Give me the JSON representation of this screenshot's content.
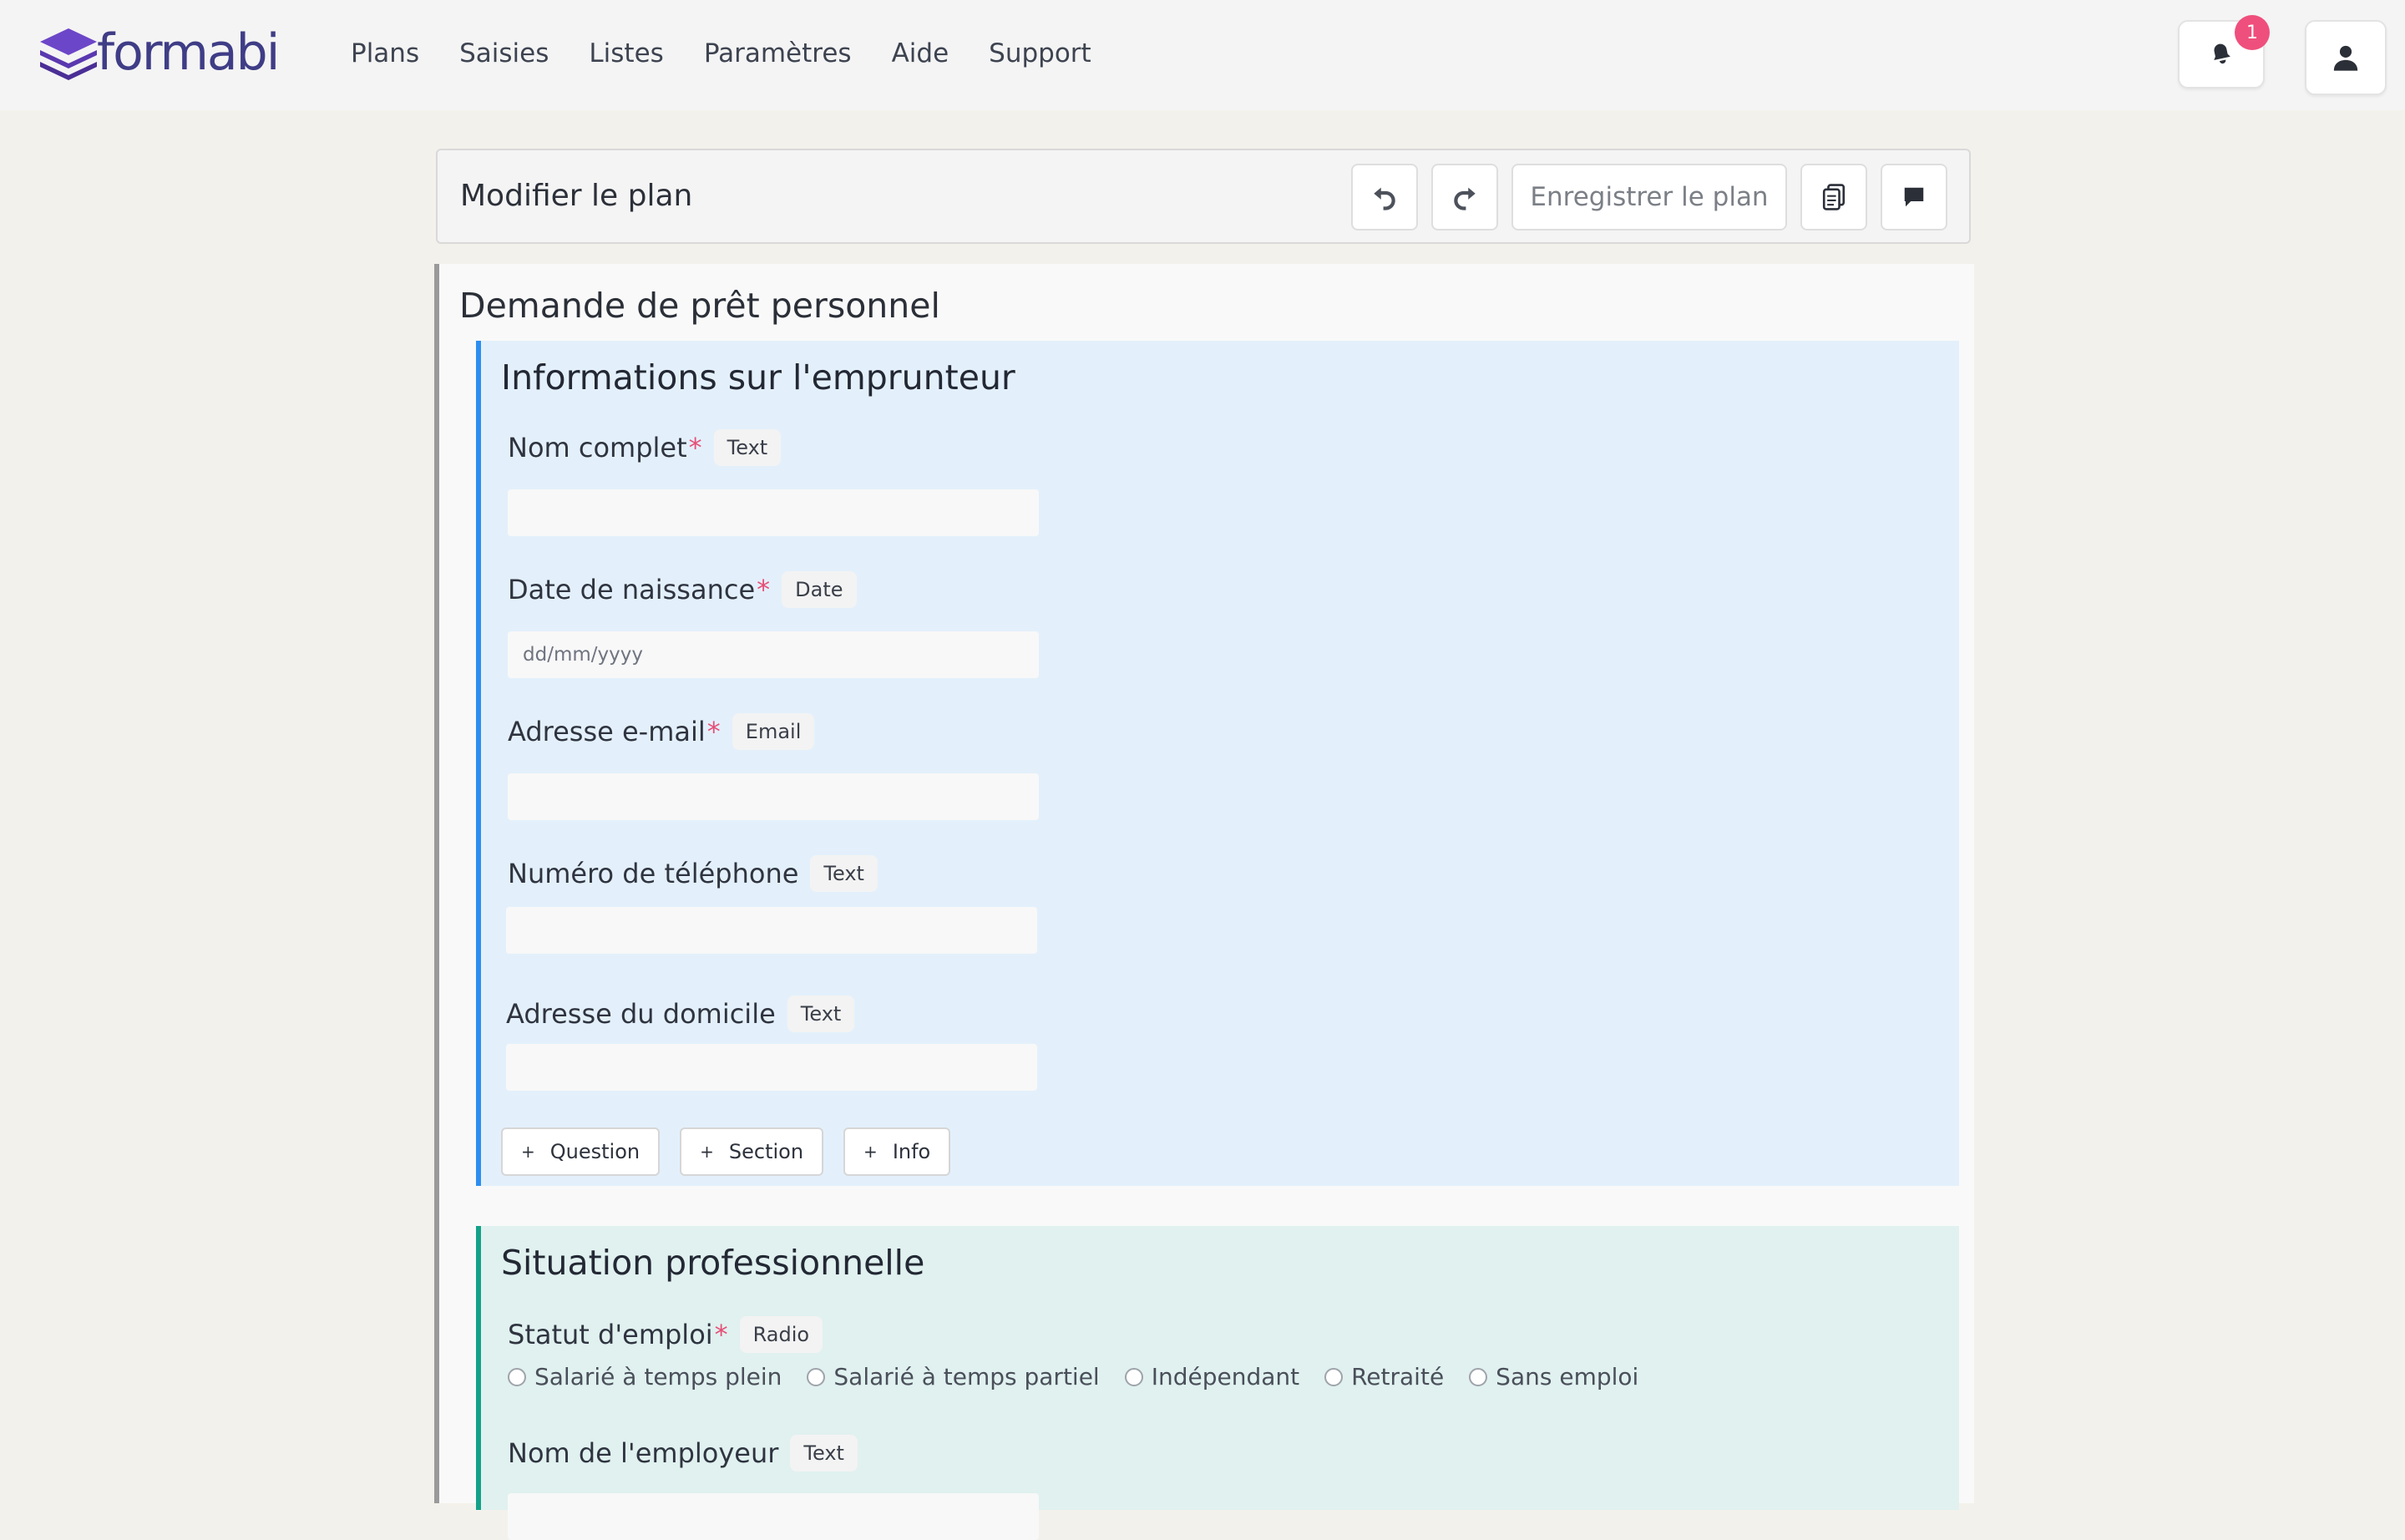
{
  "brand": {
    "name": "formabi"
  },
  "nav": {
    "items": [
      "Plans",
      "Saisies",
      "Listes",
      "Paramètres",
      "Aide",
      "Support"
    ]
  },
  "notifications": {
    "count": "1"
  },
  "toolbar": {
    "title": "Modifier le plan",
    "save_label": "Enregistrer le plan"
  },
  "form": {
    "title": "Demande de prêt personnel",
    "sections": [
      {
        "title": "Informations sur l'emprunteur",
        "questions": [
          {
            "label": "Nom complet",
            "required": true,
            "type": "Text",
            "placeholder": ""
          },
          {
            "label": "Date de naissance",
            "required": true,
            "type": "Date",
            "placeholder": "dd/mm/yyyy"
          },
          {
            "label": "Adresse e-mail",
            "required": true,
            "type": "Email",
            "placeholder": ""
          },
          {
            "label": "Numéro de téléphone",
            "required": false,
            "type": "Text",
            "placeholder": ""
          },
          {
            "label": "Adresse du domicile",
            "required": false,
            "type": "Text",
            "placeholder": ""
          }
        ],
        "add_buttons": [
          "Question",
          "Section",
          "Info"
        ]
      },
      {
        "title": "Situation professionnelle",
        "questions": [
          {
            "label": "Statut d'emploi",
            "required": true,
            "type": "Radio",
            "options": [
              "Salarié à temps plein",
              "Salarié à temps partiel",
              "Indépendant",
              "Retraité",
              "Sans emploi"
            ]
          },
          {
            "label": "Nom de l'employeur",
            "required": false,
            "type": "Text",
            "placeholder": ""
          }
        ]
      }
    ]
  },
  "colors": {
    "accent_blue": "#2d8ef0",
    "accent_green": "#13a289",
    "required_star": "#e64f77",
    "badge": "#ef4f7c",
    "logo": "#5b3fa8"
  },
  "icons": [
    "logo-icon",
    "bell-icon",
    "user-icon",
    "undo-icon",
    "redo-icon",
    "copy-icon",
    "chat-icon",
    "plus-icon"
  ]
}
